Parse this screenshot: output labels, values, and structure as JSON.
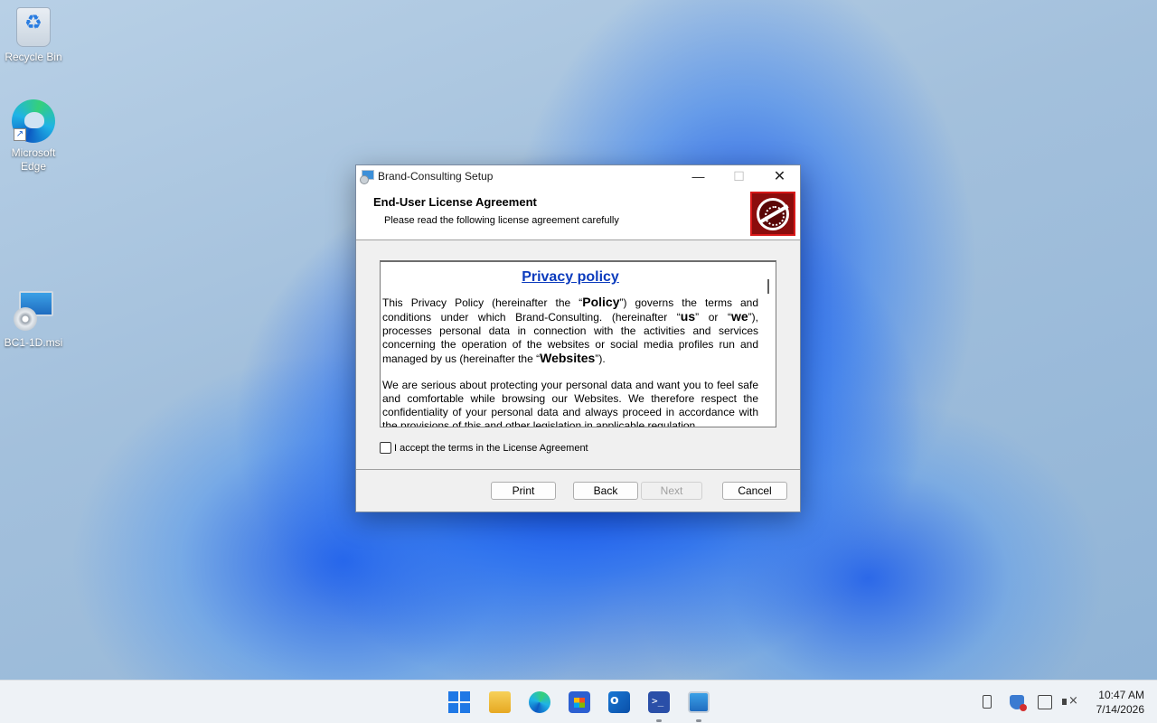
{
  "desktop": {
    "icons": [
      {
        "label": "Recycle Bin"
      },
      {
        "label": "Microsoft Edge"
      },
      {
        "label": "BC1-1D.msi"
      }
    ]
  },
  "window": {
    "title": "Brand-Consulting Setup",
    "controls": {
      "minimize": "—",
      "maximize": "☐",
      "close": "✕"
    },
    "header": {
      "title": "End-User License Agreement",
      "subtitle": "Please read the following license agreement carefully"
    },
    "license": {
      "heading": "Privacy policy",
      "p1": {
        "a": "This Privacy Policy (hereinafter the “",
        "b": "Policy",
        "c": "”) governs the terms and conditions under which Brand-Consulting. (hereinafter “",
        "d": "us",
        "e": "” or “",
        "f": "we",
        "g": "”), processes personal data in connection with the activities and services concerning the operation of the websites or social media profiles run and managed by us (hereinafter the “",
        "h": "Websites",
        "i": "”)."
      },
      "p2": "We are serious about protecting your personal data and want you to feel safe and comfortable while browsing our Websites. We therefore respect the confidentiality of your personal data and always proceed in accordance with the provisions of this and other legislation in applicable regulation."
    },
    "accept_label": "I accept the terms in the License Agreement",
    "accept_checked": false,
    "buttons": {
      "print": "Print",
      "back": "Back",
      "next": "Next",
      "cancel": "Cancel"
    }
  },
  "taskbar": {
    "apps": [
      "start-icon",
      "file-explorer-icon",
      "edge-icon",
      "store-icon",
      "outlook-icon",
      "powershell-icon",
      "setup-icon"
    ],
    "clock": {
      "time": "10:47 AM",
      "date": "7/14/2026"
    }
  },
  "colors": {
    "accent": "#1f78e5",
    "link": "#0b3bbd",
    "logo_bg": "#8b0c0c"
  }
}
